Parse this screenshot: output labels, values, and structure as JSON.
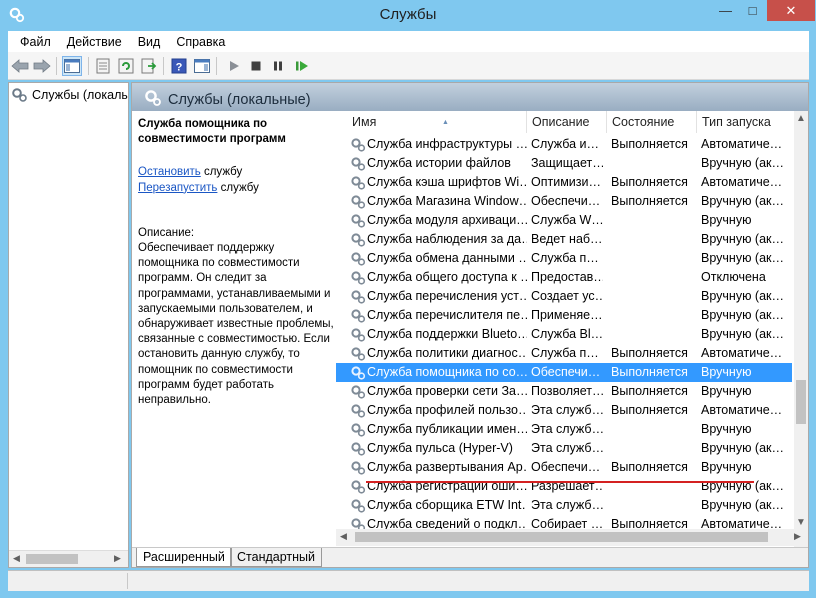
{
  "window": {
    "title": "Службы",
    "minimize": "—",
    "maximize": "□",
    "close": "✕"
  },
  "menu": [
    "Файл",
    "Действие",
    "Вид",
    "Справка"
  ],
  "tree": {
    "root_label": "Службы (локалы"
  },
  "main": {
    "header": "Службы (локальные)",
    "description_panel": {
      "service_name": "Служба помощника по совместимости программ",
      "stop_link": "Остановить",
      "stop_suffix": " службу",
      "restart_link": "Перезапустить",
      "restart_suffix": " службу",
      "description_label": "Описание:",
      "description_text": "Обеспечивает поддержку помощника по совместимости программ. Он следит за программами, устанавливаемыми и запускаемыми пользователем, и обнаруживает известные проблемы, связанные с совместимостью. Если остановить данную службу, то помощник по совместимости программ будет работать неправильно."
    },
    "columns": [
      "Имя",
      "Описание",
      "Состояние",
      "Тип запуска"
    ],
    "rows": [
      {
        "name": "Служба инфраструктуры …",
        "desc": "Служба и…",
        "state": "Выполняется",
        "start": "Автоматиче…"
      },
      {
        "name": "Служба истории файлов",
        "desc": "Защищает…",
        "state": "",
        "start": "Вручную (ак…"
      },
      {
        "name": "Служба кэша шрифтов Wi…",
        "desc": "Оптимизи…",
        "state": "Выполняется",
        "start": "Автоматиче…"
      },
      {
        "name": "Служба Магазина Window…",
        "desc": "Обеспечи…",
        "state": "Выполняется",
        "start": "Вручную (ак…"
      },
      {
        "name": "Служба модуля архиваци…",
        "desc": "Служба W…",
        "state": "",
        "start": "Вручную"
      },
      {
        "name": "Служба наблюдения за да…",
        "desc": "Ведет наб…",
        "state": "",
        "start": "Вручную (ак…"
      },
      {
        "name": "Служба обмена данными …",
        "desc": "Служба п…",
        "state": "",
        "start": "Вручную (ак…"
      },
      {
        "name": "Служба общего доступа к …",
        "desc": "Предостав…",
        "state": "",
        "start": "Отключена"
      },
      {
        "name": "Служба перечисления уст…",
        "desc": "Создает ус…",
        "state": "",
        "start": "Вручную (ак…"
      },
      {
        "name": "Служба перечислителя пе…",
        "desc": "Применяе…",
        "state": "",
        "start": "Вручную (ак…"
      },
      {
        "name": "Служба поддержки Blueto…",
        "desc": "Служба Bl…",
        "state": "",
        "start": "Вручную (ак…"
      },
      {
        "name": "Служба политики диагнос…",
        "desc": "Служба п…",
        "state": "Выполняется",
        "start": "Автоматиче…"
      },
      {
        "name": "Служба помощника по со…",
        "desc": "Обеспечи…",
        "state": "Выполняется",
        "start": "Вручную",
        "selected": true
      },
      {
        "name": "Служба проверки сети За…",
        "desc": "Позволяет…",
        "state": "Выполняется",
        "start": "Вручную"
      },
      {
        "name": "Служба профилей пользо…",
        "desc": "Эта служб…",
        "state": "Выполняется",
        "start": "Автоматиче…"
      },
      {
        "name": "Служба публикации имен…",
        "desc": "Эта служб…",
        "state": "",
        "start": "Вручную"
      },
      {
        "name": "Служба пульса (Hyper-V)",
        "desc": "Эта служб…",
        "state": "",
        "start": "Вручную (ак…"
      },
      {
        "name": "Служба развертывания Ap…",
        "desc": "Обеспечи…",
        "state": "Выполняется",
        "start": "Вручную"
      },
      {
        "name": "Служба регистрации оши…",
        "desc": "Разрешает…",
        "state": "",
        "start": "Вручную (ак…"
      },
      {
        "name": "Служба сборщика ETW Int…",
        "desc": "Эта служб…",
        "state": "",
        "start": "Вручную (ак…"
      },
      {
        "name": "Служба сведений о подкл…",
        "desc": "Собирает …",
        "state": "Выполняется",
        "start": "Автоматиче…"
      }
    ],
    "tabs": [
      "Расширенный",
      "Стандартный"
    ]
  },
  "colors": {
    "selection": "#3399ff",
    "link": "#1a56c4",
    "close_button": "#c7504a",
    "window_frame": "#7fc8ef",
    "annotation_line": "#d42121"
  }
}
